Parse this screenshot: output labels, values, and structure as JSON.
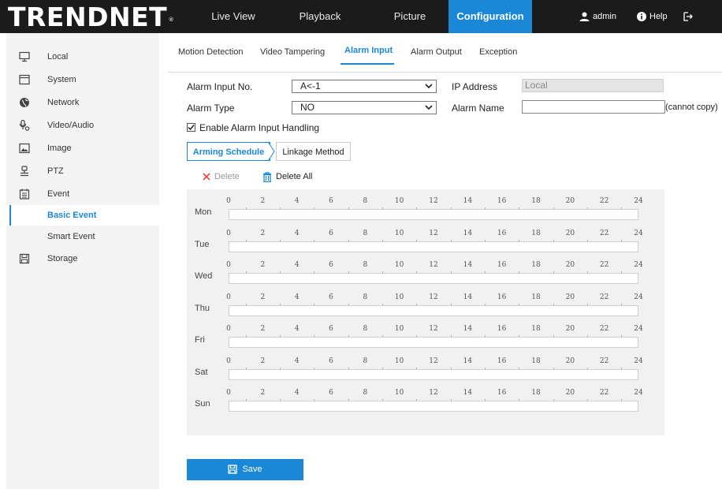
{
  "app": {
    "logo": "TRENDNET",
    "trademark": "®"
  },
  "nav": [
    {
      "label": "Live View",
      "active": false
    },
    {
      "label": "Playback",
      "active": false
    },
    {
      "label": "Picture",
      "active": false
    },
    {
      "label": "Configuration",
      "active": true
    }
  ],
  "user": {
    "name": "admin",
    "help": "Help",
    "logout": "Logout"
  },
  "sidebar": {
    "items": [
      {
        "label": "Local",
        "icon": "monitor-icon"
      },
      {
        "label": "System",
        "icon": "window-icon"
      },
      {
        "label": "Network",
        "icon": "globe-icon"
      },
      {
        "label": "Video/Audio",
        "icon": "microphone-icon"
      },
      {
        "label": "Image",
        "icon": "image-icon"
      },
      {
        "label": "PTZ",
        "icon": "ptz-icon"
      },
      {
        "label": "Event",
        "icon": "calendar-icon"
      },
      {
        "label": "Basic Event",
        "active": true
      },
      {
        "label": "Smart Event"
      },
      {
        "label": "Storage",
        "icon": "floppy-icon"
      }
    ]
  },
  "tabs": [
    {
      "label": "Motion Detection"
    },
    {
      "label": "Video Tampering"
    },
    {
      "label": "Alarm Input",
      "active": true
    },
    {
      "label": "Alarm Output"
    },
    {
      "label": "Exception"
    }
  ],
  "form": {
    "alarm_input_no_label": "Alarm Input No.",
    "alarm_input_no_value": "A<-1",
    "alarm_type_label": "Alarm Type",
    "alarm_type_value": "NO",
    "ip_address_label": "IP Address",
    "ip_address_value": "Local",
    "alarm_name_label": "Alarm Name",
    "alarm_name_value": "",
    "cannot_copy": "(cannot copy)",
    "enable_label": "Enable Alarm Input Handling",
    "enable_checked": true
  },
  "subtabs": [
    {
      "label": "Arming Schedule",
      "active": true
    },
    {
      "label": "Linkage Method"
    }
  ],
  "toolbar": {
    "delete_label": "Delete",
    "delete_all_label": "Delete All"
  },
  "schedule": {
    "days": [
      "Mon",
      "Tue",
      "Wed",
      "Thu",
      "Fri",
      "Sat",
      "Sun"
    ],
    "hour_ticks": [
      "0",
      "2",
      "4",
      "6",
      "8",
      "10",
      "12",
      "14",
      "16",
      "18",
      "20",
      "22",
      "24"
    ]
  },
  "save_label": "Save",
  "colors": {
    "accent": "#1a88d6",
    "topbar": "#1b1b1b",
    "sidebar": "#f4f4f4",
    "delete": "#e04a3f"
  }
}
